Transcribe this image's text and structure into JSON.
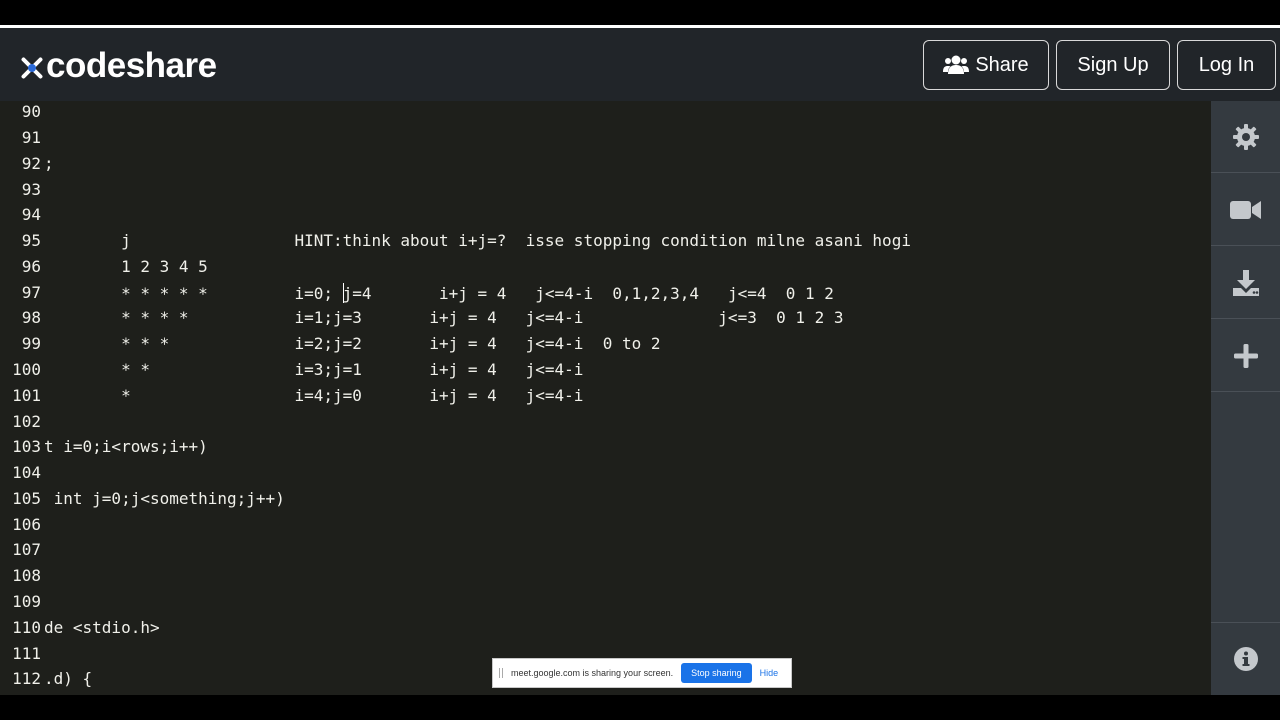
{
  "app": {
    "name": "codeshare"
  },
  "header": {
    "share_label": "Share",
    "signup_label": "Sign Up",
    "login_label": "Log In"
  },
  "editor": {
    "lines": [
      {
        "num": "90",
        "text": ""
      },
      {
        "num": "91",
        "text": ""
      },
      {
        "num": "92",
        "text": ";"
      },
      {
        "num": "93",
        "text": ""
      },
      {
        "num": "94",
        "text": ""
      },
      {
        "num": "95",
        "text": "        j                 HINT:think about i+j=?  isse stopping condition milne asani hogi"
      },
      {
        "num": "96",
        "text": "        1 2 3 4 5"
      },
      {
        "num": "97",
        "text_before_cursor": "        * * * * *         i=0; ",
        "text_after_cursor": "j=4       i+j = 4   j<=4-i  0,1,2,3,4   j<=4  0 1 2"
      },
      {
        "num": "98",
        "text": "        * * * *           i=1;j=3       i+j = 4   j<=4-i              j<=3  0 1 2 3"
      },
      {
        "num": "99",
        "text": "        * * *             i=2;j=2       i+j = 4   j<=4-i  0 to 2"
      },
      {
        "num": "100",
        "text": "        * *               i=3;j=1       i+j = 4   j<=4-i"
      },
      {
        "num": "101",
        "text": "        *                 i=4;j=0       i+j = 4   j<=4-i"
      },
      {
        "num": "102",
        "text": ""
      },
      {
        "num": "103",
        "text": "t i=0;i<rows;i++)"
      },
      {
        "num": "104",
        "text": ""
      },
      {
        "num": "105",
        "text": " int j=0;j<something;j++)"
      },
      {
        "num": "106",
        "text": ""
      },
      {
        "num": "107",
        "text": ""
      },
      {
        "num": "108",
        "text": ""
      },
      {
        "num": "109",
        "text": ""
      },
      {
        "num": "110",
        "text": "de <stdio.h>"
      },
      {
        "num": "111",
        "text": ""
      },
      {
        "num": "112",
        "text": ".d) {"
      }
    ]
  },
  "sidebar": {
    "icons": [
      "gear-icon",
      "video-camera-icon",
      "download-icon",
      "plus-icon",
      "info-icon"
    ]
  },
  "screen_share": {
    "message": "meet.google.com is sharing your screen.",
    "stop_label": "Stop sharing",
    "hide_label": "Hide"
  },
  "colors": {
    "header_bg": "#212529",
    "editor_bg": "#1e1f1b",
    "sidebar_bg": "#343a40",
    "accent": "#1a73e8"
  }
}
